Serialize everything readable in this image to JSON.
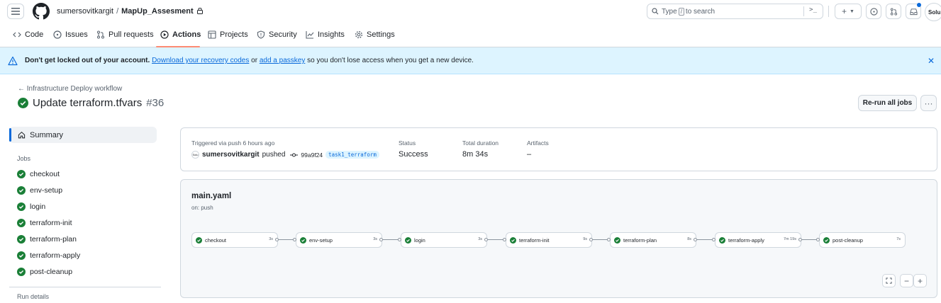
{
  "header": {
    "owner": "sumersovitkargit",
    "separator": "/",
    "repo": "MapUp_Assesment",
    "search_prefix": "Type",
    "search_key": "/",
    "search_suffix": "to search",
    "avatar_text": "Solu"
  },
  "tabs": [
    {
      "label": "Code",
      "icon": "code-icon"
    },
    {
      "label": "Issues",
      "icon": "issue-icon"
    },
    {
      "label": "Pull requests",
      "icon": "pull-request-icon"
    },
    {
      "label": "Actions",
      "icon": "play-icon",
      "active": true
    },
    {
      "label": "Projects",
      "icon": "table-icon"
    },
    {
      "label": "Security",
      "icon": "shield-icon"
    },
    {
      "label": "Insights",
      "icon": "graph-icon"
    },
    {
      "label": "Settings",
      "icon": "gear-icon"
    }
  ],
  "banner": {
    "bold": "Don't get locked out of your account.",
    "link1": "Download your recovery codes",
    "mid": "or",
    "link2": "add a passkey",
    "tail": "so you don't lose access when you get a new device."
  },
  "run": {
    "back_label": "Infrastructure Deploy workflow",
    "title": "Update terraform.tfvars",
    "number": "#36",
    "rerun_label": "Re-run all jobs"
  },
  "sidebar": {
    "summary_label": "Summary",
    "jobs_label": "Jobs",
    "jobs": [
      "checkout",
      "env-setup",
      "login",
      "terraform-init",
      "terraform-plan",
      "terraform-apply",
      "post-cleanup"
    ],
    "run_details_label": "Run details"
  },
  "summary_card": {
    "trigger": "Triggered via push 6 hours ago",
    "mini_avatar": "Solu",
    "user": "sumersovitkargit",
    "action": "pushed",
    "sha": "99a9f24",
    "branch": "task1_terraform",
    "status_label": "Status",
    "status_value": "Success",
    "duration_label": "Total duration",
    "duration_value": "8m 34s",
    "artifacts_label": "Artifacts",
    "artifacts_value": "–"
  },
  "graph": {
    "workflow_file": "main.yaml",
    "on": "on: push",
    "nodes": [
      {
        "name": "checkout",
        "duration": "3s"
      },
      {
        "name": "env-setup",
        "duration": "3s"
      },
      {
        "name": "login",
        "duration": "3s"
      },
      {
        "name": "terraform-init",
        "duration": "9s"
      },
      {
        "name": "terraform-plan",
        "duration": "8s"
      },
      {
        "name": "terraform-apply",
        "duration": "7m 19s"
      },
      {
        "name": "post-cleanup",
        "duration": "7s"
      }
    ]
  },
  "colors": {
    "success": "#1a7f37",
    "accent": "#0969da",
    "tab_underline": "#fd8c73",
    "banner_bg": "#ddf4ff"
  }
}
